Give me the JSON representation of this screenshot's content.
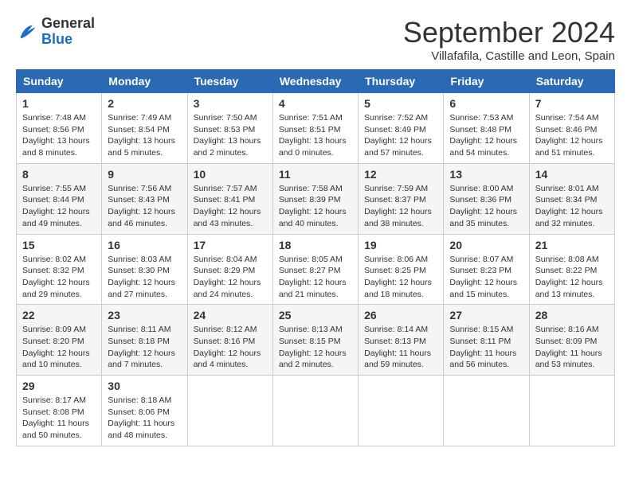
{
  "logo": {
    "general": "General",
    "blue": "Blue"
  },
  "title": "September 2024",
  "location": "Villafafila, Castille and Leon, Spain",
  "days_header": [
    "Sunday",
    "Monday",
    "Tuesday",
    "Wednesday",
    "Thursday",
    "Friday",
    "Saturday"
  ],
  "weeks": [
    [
      {
        "day": "1",
        "info": "Sunrise: 7:48 AM\nSunset: 8:56 PM\nDaylight: 13 hours\nand 8 minutes."
      },
      {
        "day": "2",
        "info": "Sunrise: 7:49 AM\nSunset: 8:54 PM\nDaylight: 13 hours\nand 5 minutes."
      },
      {
        "day": "3",
        "info": "Sunrise: 7:50 AM\nSunset: 8:53 PM\nDaylight: 13 hours\nand 2 minutes."
      },
      {
        "day": "4",
        "info": "Sunrise: 7:51 AM\nSunset: 8:51 PM\nDaylight: 13 hours\nand 0 minutes."
      },
      {
        "day": "5",
        "info": "Sunrise: 7:52 AM\nSunset: 8:49 PM\nDaylight: 12 hours\nand 57 minutes."
      },
      {
        "day": "6",
        "info": "Sunrise: 7:53 AM\nSunset: 8:48 PM\nDaylight: 12 hours\nand 54 minutes."
      },
      {
        "day": "7",
        "info": "Sunrise: 7:54 AM\nSunset: 8:46 PM\nDaylight: 12 hours\nand 51 minutes."
      }
    ],
    [
      {
        "day": "8",
        "info": "Sunrise: 7:55 AM\nSunset: 8:44 PM\nDaylight: 12 hours\nand 49 minutes."
      },
      {
        "day": "9",
        "info": "Sunrise: 7:56 AM\nSunset: 8:43 PM\nDaylight: 12 hours\nand 46 minutes."
      },
      {
        "day": "10",
        "info": "Sunrise: 7:57 AM\nSunset: 8:41 PM\nDaylight: 12 hours\nand 43 minutes."
      },
      {
        "day": "11",
        "info": "Sunrise: 7:58 AM\nSunset: 8:39 PM\nDaylight: 12 hours\nand 40 minutes."
      },
      {
        "day": "12",
        "info": "Sunrise: 7:59 AM\nSunset: 8:37 PM\nDaylight: 12 hours\nand 38 minutes."
      },
      {
        "day": "13",
        "info": "Sunrise: 8:00 AM\nSunset: 8:36 PM\nDaylight: 12 hours\nand 35 minutes."
      },
      {
        "day": "14",
        "info": "Sunrise: 8:01 AM\nSunset: 8:34 PM\nDaylight: 12 hours\nand 32 minutes."
      }
    ],
    [
      {
        "day": "15",
        "info": "Sunrise: 8:02 AM\nSunset: 8:32 PM\nDaylight: 12 hours\nand 29 minutes."
      },
      {
        "day": "16",
        "info": "Sunrise: 8:03 AM\nSunset: 8:30 PM\nDaylight: 12 hours\nand 27 minutes."
      },
      {
        "day": "17",
        "info": "Sunrise: 8:04 AM\nSunset: 8:29 PM\nDaylight: 12 hours\nand 24 minutes."
      },
      {
        "day": "18",
        "info": "Sunrise: 8:05 AM\nSunset: 8:27 PM\nDaylight: 12 hours\nand 21 minutes."
      },
      {
        "day": "19",
        "info": "Sunrise: 8:06 AM\nSunset: 8:25 PM\nDaylight: 12 hours\nand 18 minutes."
      },
      {
        "day": "20",
        "info": "Sunrise: 8:07 AM\nSunset: 8:23 PM\nDaylight: 12 hours\nand 15 minutes."
      },
      {
        "day": "21",
        "info": "Sunrise: 8:08 AM\nSunset: 8:22 PM\nDaylight: 12 hours\nand 13 minutes."
      }
    ],
    [
      {
        "day": "22",
        "info": "Sunrise: 8:09 AM\nSunset: 8:20 PM\nDaylight: 12 hours\nand 10 minutes."
      },
      {
        "day": "23",
        "info": "Sunrise: 8:11 AM\nSunset: 8:18 PM\nDaylight: 12 hours\nand 7 minutes."
      },
      {
        "day": "24",
        "info": "Sunrise: 8:12 AM\nSunset: 8:16 PM\nDaylight: 12 hours\nand 4 minutes."
      },
      {
        "day": "25",
        "info": "Sunrise: 8:13 AM\nSunset: 8:15 PM\nDaylight: 12 hours\nand 2 minutes."
      },
      {
        "day": "26",
        "info": "Sunrise: 8:14 AM\nSunset: 8:13 PM\nDaylight: 11 hours\nand 59 minutes."
      },
      {
        "day": "27",
        "info": "Sunrise: 8:15 AM\nSunset: 8:11 PM\nDaylight: 11 hours\nand 56 minutes."
      },
      {
        "day": "28",
        "info": "Sunrise: 8:16 AM\nSunset: 8:09 PM\nDaylight: 11 hours\nand 53 minutes."
      }
    ],
    [
      {
        "day": "29",
        "info": "Sunrise: 8:17 AM\nSunset: 8:08 PM\nDaylight: 11 hours\nand 50 minutes."
      },
      {
        "day": "30",
        "info": "Sunrise: 8:18 AM\nSunset: 8:06 PM\nDaylight: 11 hours\nand 48 minutes."
      },
      {
        "day": "",
        "info": ""
      },
      {
        "day": "",
        "info": ""
      },
      {
        "day": "",
        "info": ""
      },
      {
        "day": "",
        "info": ""
      },
      {
        "day": "",
        "info": ""
      }
    ]
  ]
}
